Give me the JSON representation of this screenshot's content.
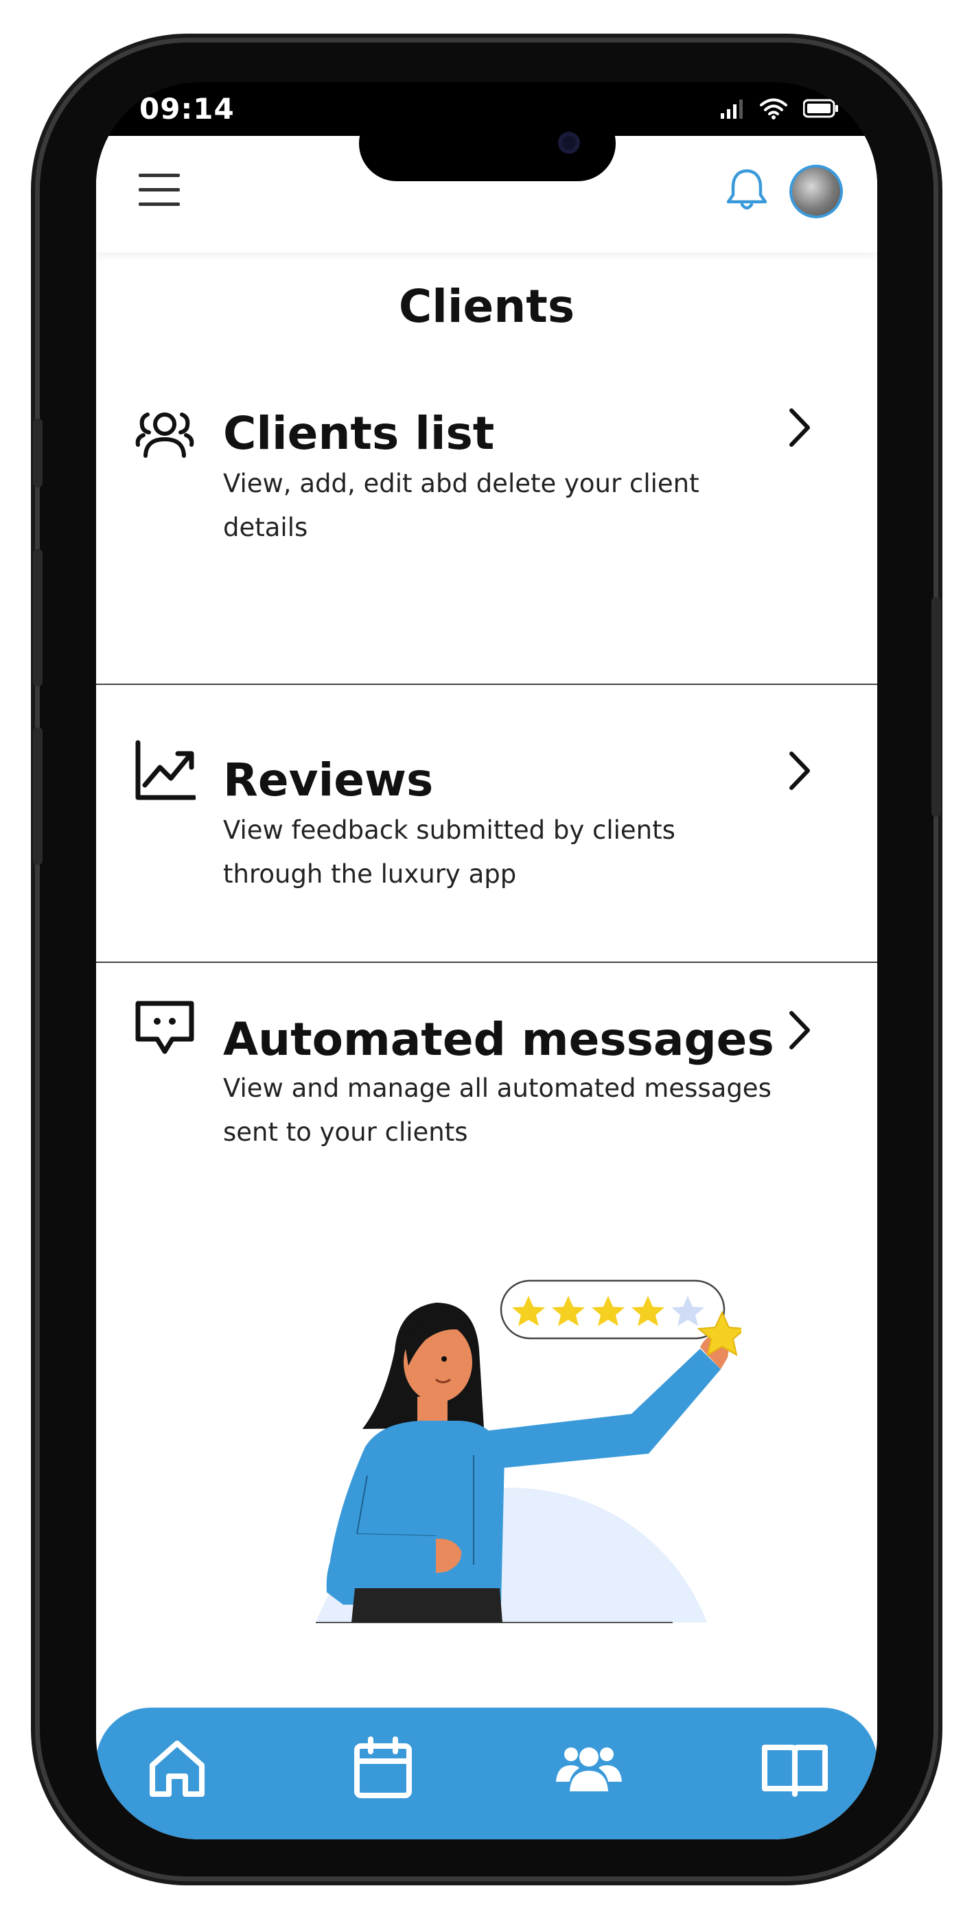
{
  "status_bar": {
    "time": "09:14"
  },
  "header": {
    "menu_icon": "hamburger-icon",
    "notification_icon": "bell-icon",
    "avatar": "user-avatar"
  },
  "page": {
    "title": "Clients"
  },
  "menu": [
    {
      "icon": "users-icon",
      "title": "Clients list",
      "description": "View, add, edit abd delete your client details"
    },
    {
      "icon": "chart-line-icon",
      "title": "Reviews",
      "description": "View feedback submitted by clients through the luxury app"
    },
    {
      "icon": "chat-icon",
      "title": "Automated messages",
      "description": "View and manage all automated messages sent to your clients"
    }
  ],
  "illustration": {
    "rating_stars_filled": 4,
    "rating_stars_total": 5
  },
  "bottom_nav": [
    {
      "icon": "home-icon"
    },
    {
      "icon": "calendar-icon"
    },
    {
      "icon": "clients-icon"
    },
    {
      "icon": "book-icon"
    }
  ],
  "colors": {
    "accent": "#3a9ad9",
    "star": "#f5d020",
    "illustration_bg": "#e6effd",
    "skin": "#e88a5c"
  }
}
